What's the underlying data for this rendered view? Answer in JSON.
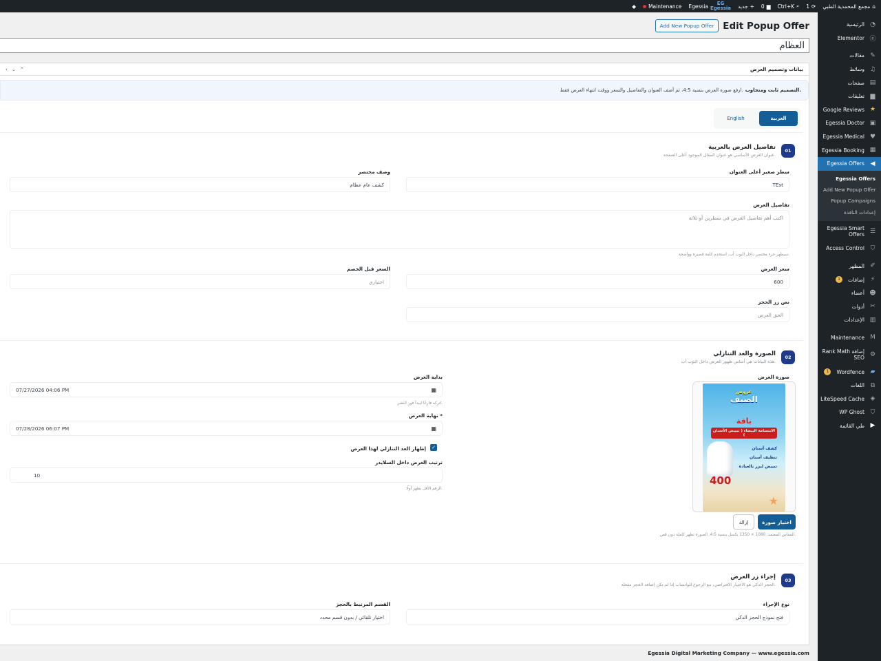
{
  "adminbar": {
    "site_name": "مجمع المحمدية الطبي",
    "updates": "1",
    "search_shortcut": "Ctrl+K",
    "comments": "0",
    "new_label": "جديد",
    "egessia_logo": "Egessia",
    "egessia_label": "Egessia",
    "maintenance": "Maintenance"
  },
  "sidebar": {
    "items": [
      {
        "label": "الرئيسية",
        "icon": "dashboard-icon"
      },
      {
        "label": "Elementor",
        "icon": "elementor-icon"
      },
      {
        "label": "مقالات",
        "icon": "pin-icon"
      },
      {
        "label": "وسائط",
        "icon": "media-icon"
      },
      {
        "label": "صفحات",
        "icon": "pages-icon"
      },
      {
        "label": "تعليقات",
        "icon": "comments-icon"
      },
      {
        "label": "Google Reviews",
        "icon": "star-icon"
      },
      {
        "label": "Egessia Doctor",
        "icon": "doctor-icon"
      },
      {
        "label": "Egessia Medical",
        "icon": "heart-icon"
      },
      {
        "label": "Egessia Booking",
        "icon": "calendar-icon"
      },
      {
        "label": "Egessia Offers",
        "icon": "megaphone-icon"
      }
    ],
    "submenu": [
      "Egessia Offers",
      "Add New Popup Offer",
      "Popup Campaigns",
      "إعدادات النافذة"
    ],
    "items2": [
      {
        "label": "Egessia Smart Offers",
        "icon": "smart-offers-icon"
      },
      {
        "label": "Access Control",
        "icon": "shield-icon"
      },
      {
        "label": "المظهر",
        "icon": "appearance-icon"
      },
      {
        "label": "إضافات",
        "icon": "plugins-icon",
        "badge": "1"
      },
      {
        "label": "أعضاء",
        "icon": "users-icon"
      },
      {
        "label": "أدوات",
        "icon": "tools-icon"
      },
      {
        "label": "الإعدادات",
        "icon": "settings-icon"
      },
      {
        "label": "Maintenance",
        "icon": "maintenance-icon"
      },
      {
        "label": "Rank Math إضافة SEO",
        "icon": "rankmath-icon"
      },
      {
        "label": "Wordfence",
        "icon": "wordfence-icon",
        "badge": "1"
      },
      {
        "label": "اللغات",
        "icon": "languages-icon"
      },
      {
        "label": "LiteSpeed Cache",
        "icon": "litespeed-icon"
      },
      {
        "label": "WP Ghost",
        "icon": "ghost-icon"
      },
      {
        "label": "طي القائمة",
        "icon": "collapse-icon"
      }
    ]
  },
  "page": {
    "title": "Edit Popup Offer",
    "add_new": "Add New Popup Offer",
    "post_title": "العظام"
  },
  "metabox": {
    "title": "بيانات وتصميم العرض",
    "intro_bold": "التصميم ثابت ومتجاوب.",
    "intro_text": "ارفع صورة العرض بنسبة 4:5، ثم أضف العنوان والتفاصيل والسعر ووقت انتهاء العرض فقط.",
    "lang_ar": "العربية",
    "lang_en": "English"
  },
  "section1": {
    "num": "01",
    "title": "تفاصيل العرض بالعربية",
    "subtitle": "عنوان العرض الأساسي هو عنوان المقال الموجود أعلى الصفحة.",
    "subtitle_label": "سطر صغير أعلى العنوان",
    "subtitle_value": "TEst",
    "short_desc_label": "وصف مختصر",
    "short_desc_value": "كشف عام عظام",
    "details_label": "تفاصيل العرض",
    "details_placeholder": "اكتب أهم تفاصيل العرض في سطرين أو ثلاثة",
    "details_hint": "سيظهر جزء مختصر داخل البوب أب. استخدم كلمة قصيرة وواضحة.",
    "price_label": "سعر العرض",
    "price_value": "600",
    "old_price_label": "السعر قبل الخصم",
    "old_price_placeholder": "اختياري",
    "button_label": "نص زر الحجز",
    "button_placeholder": "الحق العرض"
  },
  "section2": {
    "num": "02",
    "title": "الصورة والعد التنازلي",
    "subtitle": "هذه البيانات هي أساس ظهور العرض داخل البوب أب.",
    "image_label": "صورة العرض",
    "choose_image": "اختيار صورة",
    "remove": "إزالة",
    "image_hint": "المقاس المعتمد: 1080 × 1350 بكسل بنسبة 4:5. الصورة تظهر كاملة دون قص.",
    "start_label": "بداية العرض",
    "start_value": "07/27/2026 04:06 PM",
    "start_hint": "اتركه فارغًا ليبدأ فور النشر.",
    "end_label": "نهاية العرض *",
    "end_value": "07/28/2026 06:07 PM",
    "countdown_label": "إظهار العد التنازلي لهذا العرض",
    "order_label": "ترتيب العرض داخل السلايدر",
    "order_value": "10",
    "order_hint": "الرقم الأقل يظهر أولًا.",
    "poster": {
      "top_small": "عروض",
      "top": "الصيف",
      "baqa": "باقة",
      "red": "الابتسامة البيضاء ( تبييض الأسنان )",
      "list": [
        "كشف أسنان",
        "تنظيف أسنان",
        "تبييض ليزر بالعيادة"
      ],
      "price": "400"
    }
  },
  "section3": {
    "num": "03",
    "title": "إجراء زر العرض",
    "subtitle": "الحجز الذكي هو الاختيار الافتراضي، مع الرجوع للواتساب إذا لم تكن إضافة الحجز مفعلة.",
    "action_label": "نوع الإجراء",
    "action_value": "فتح نموذج الحجز الذكي",
    "dept_label": "القسم المرتبط بالحجز",
    "dept_value": "اختيار تلقائي / بدون قسم محدد"
  },
  "footer": "Egessia Digital Marketing Company — www.egessia.com"
}
